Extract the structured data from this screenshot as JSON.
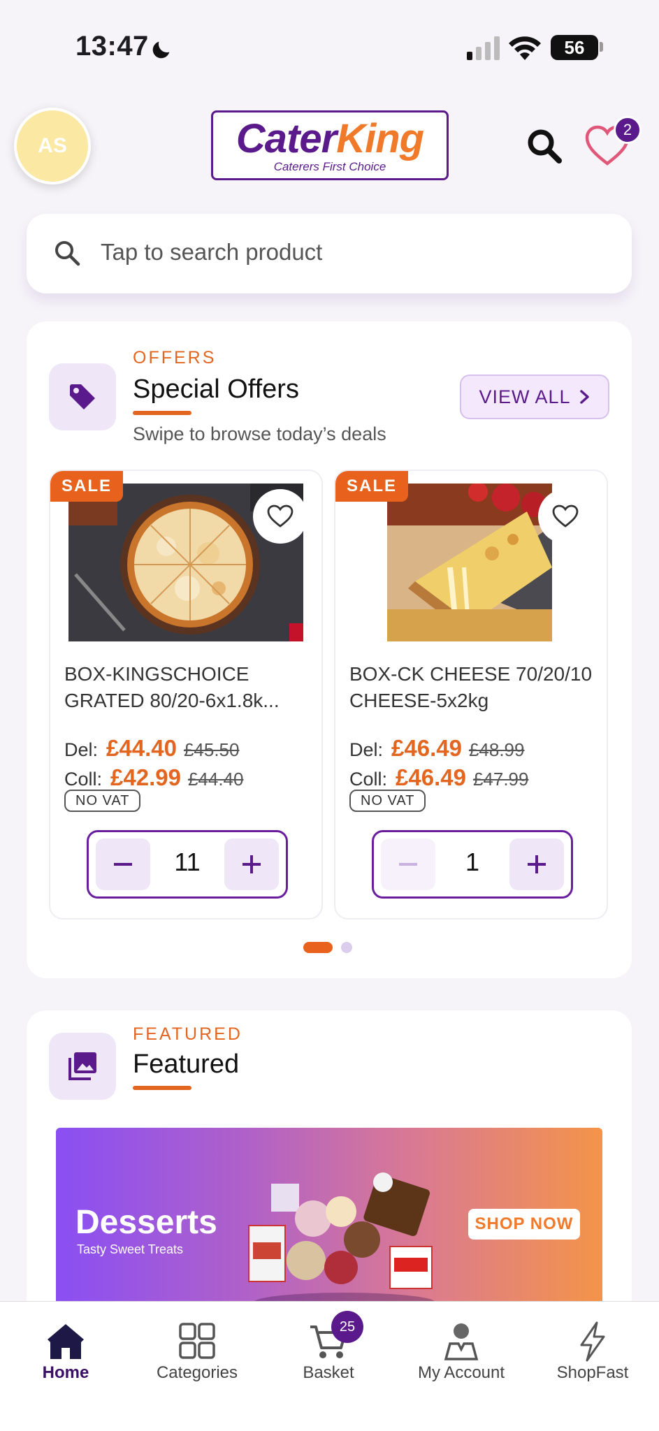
{
  "status_bar": {
    "time": "13:47",
    "battery": "56"
  },
  "header": {
    "avatar_initials": "AS",
    "logo_part1": "Cater",
    "logo_part2": "King",
    "logo_tagline": "Caterers First Choice",
    "wishlist_count": "2"
  },
  "search": {
    "placeholder": "Tap to search product"
  },
  "offers": {
    "eyebrow": "OFFERS",
    "title": "Special Offers",
    "subtitle": "Swipe to browse today’s deals",
    "view_all": "VIEW ALL",
    "sale_label": "SALE",
    "no_vat_label": "NO VAT",
    "del_label": "Del:",
    "coll_label": "Coll:",
    "products": [
      {
        "name": "BOX-KINGSCHOICE GRATED 80/20-6x1.8k...",
        "del_price": "£44.40",
        "del_was": "£45.50",
        "coll_price": "£42.99",
        "coll_was": "£44.40",
        "quantity": "11"
      },
      {
        "name": "BOX-CK CHEESE 70/20/10 CHEESE-5x2kg",
        "del_price": "£46.49",
        "del_was": "£48.99",
        "coll_price": "£46.49",
        "coll_was": "£47.99",
        "quantity": "1"
      }
    ]
  },
  "featured": {
    "eyebrow": "FEATURED",
    "title": "Featured",
    "banner": {
      "title": "Desserts",
      "subtitle": "Tasty Sweet Treats",
      "cta": "SHOP NOW"
    }
  },
  "bottom_nav": {
    "items": [
      {
        "label": "Home",
        "icon": "home-icon",
        "active": true
      },
      {
        "label": "Categories",
        "icon": "grid-icon"
      },
      {
        "label": "Basket",
        "icon": "cart-icon"
      },
      {
        "label": "My Account",
        "icon": "account-icon"
      },
      {
        "label": "ShopFast",
        "icon": "lightning-icon"
      }
    ],
    "basket_count": "25"
  },
  "colors": {
    "brand_purple": "#5a1a8c",
    "accent_orange": "#e2661f",
    "background": "#f6f4f9"
  }
}
